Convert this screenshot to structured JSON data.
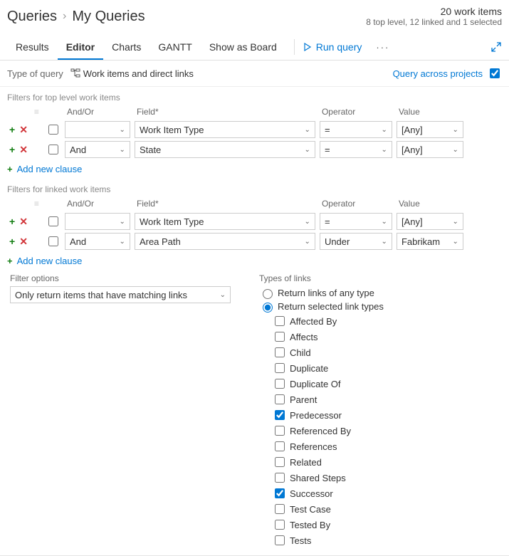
{
  "breadcrumb": {
    "root": "Queries",
    "current": "My Queries"
  },
  "stats": {
    "main": "20 work items",
    "sub": "8 top level, 12 linked and 1 selected"
  },
  "tabs": [
    "Results",
    "Editor",
    "Charts",
    "GANTT",
    "Show as Board"
  ],
  "activeTabIndex": 1,
  "runQuery": "Run query",
  "queryType": {
    "label": "Type of query",
    "value": "Work items and direct links"
  },
  "across": "Query across projects",
  "columns": {
    "andor": "And/Or",
    "field": "Field*",
    "operator": "Operator",
    "value": "Value"
  },
  "topSection": "Filters for top level work items",
  "topRows": [
    {
      "andor": "",
      "field": "Work Item Type",
      "op": "=",
      "val": "[Any]"
    },
    {
      "andor": "And",
      "field": "State",
      "op": "=",
      "val": "[Any]"
    }
  ],
  "linkedSection": "Filters for linked work items",
  "linkedRows": [
    {
      "andor": "",
      "field": "Work Item Type",
      "op": "=",
      "val": "[Any]"
    },
    {
      "andor": "And",
      "field": "Area Path",
      "op": "Under",
      "val": "Fabrikam"
    }
  ],
  "addClause": "Add new clause",
  "filterOptions": {
    "label": "Filter options",
    "value": "Only return items that have matching links"
  },
  "linkTypesLabel": "Types of links",
  "radioAny": "Return links of any type",
  "radioSel": "Return selected link types",
  "linkTypes": [
    {
      "name": "Affected By",
      "checked": false
    },
    {
      "name": "Affects",
      "checked": false
    },
    {
      "name": "Child",
      "checked": false
    },
    {
      "name": "Duplicate",
      "checked": false
    },
    {
      "name": "Duplicate Of",
      "checked": false
    },
    {
      "name": "Parent",
      "checked": false
    },
    {
      "name": "Predecessor",
      "checked": true
    },
    {
      "name": "Referenced By",
      "checked": false
    },
    {
      "name": "References",
      "checked": false
    },
    {
      "name": "Related",
      "checked": false
    },
    {
      "name": "Shared Steps",
      "checked": false
    },
    {
      "name": "Successor",
      "checked": true
    },
    {
      "name": "Test Case",
      "checked": false
    },
    {
      "name": "Tested By",
      "checked": false
    },
    {
      "name": "Tests",
      "checked": false
    }
  ]
}
